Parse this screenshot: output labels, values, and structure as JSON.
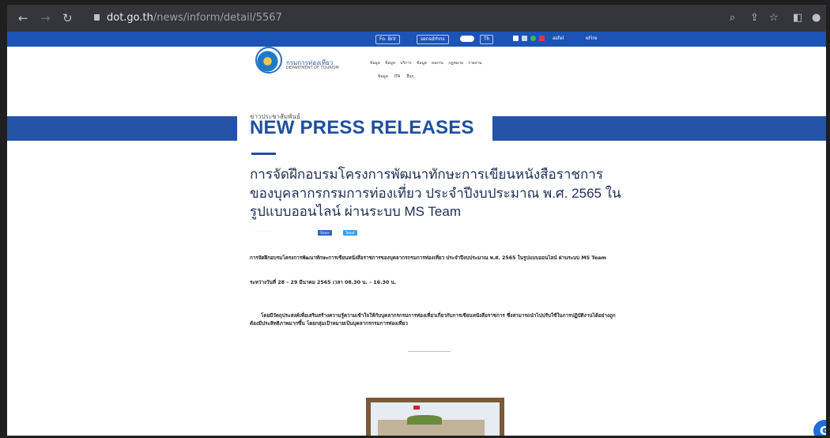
{
  "browser": {
    "host": "dot.go.th",
    "path": "/news/inform/detail/5567"
  },
  "sitebar": {
    "font_size_label": "Fo. Brlr",
    "theme_label": "sensdrhns",
    "lang_label": "Th",
    "login_label": "eFire",
    "search_label": "asfel",
    "colors": {
      "bar": "#1b54b6"
    }
  },
  "header": {
    "brand_th": "กรมการท่องเที่ยว",
    "brand_en": "DEPARTMENT OF TOURISM",
    "menu_row1": [
      "ข้อมูล",
      "ข้อมูล",
      "บริการ",
      "ข้อมูล",
      "ผลงาน",
      "กฎหมาย",
      "รายงาน"
    ],
    "menu_row2": [
      "ข้อมูล",
      "ITA",
      "อื่นๆ"
    ]
  },
  "page": {
    "breadcrumb": "ข่าวประชาสัมพันธ์",
    "heading": "NEW PRESS RELEASES",
    "title": "การจัดฝึกอบรมโครงการพัฒนาทักษะการเขียนหนังสือราชการของบุคลากรกรมการท่องเที่ยว ประจำปีงบประมาณ พ.ศ. 2565 ในรูปแบบออนไลน์ ผ่านระบบ MS Team",
    "share_facebook": "Share",
    "share_twitter": "Tweet",
    "para1": "การจัดฝึกอบรมโครงการพัฒนาทักษะการเขียนหนังสือราชการของบุคลากรกรมการท่องเที่ยว ประจำปีงบประมาณ พ.ศ. 2565 ในรูปแบบออนไลน์ ผ่านระบบ MS Team",
    "para2": "ระหว่างวันที่ 28 – 29 มีนาคม 2565 เวลา 08.30 น. – 16.30 น.",
    "para3": "โดยมีวัตถุประสงค์เพื่อเสริมสร้างความรู้ความเข้าใจให้กับบุคลากรกรมการท่องเที่ยวเกี่ยวกับการเขียนหนังสือราชการ ซึ่งสามารถนำไปปรับใช้ในการปฏิบัติงานได้อย่างถูกต้องมีประสิทธิภาพมากขึ้น โดยกลุ่มเป้าหมายเป็นบุคลากรกรมการท่องเที่ยว",
    "separator": "-------------------------",
    "colors": {
      "accent": "#1e4fa0",
      "band": "#2553a8"
    }
  }
}
